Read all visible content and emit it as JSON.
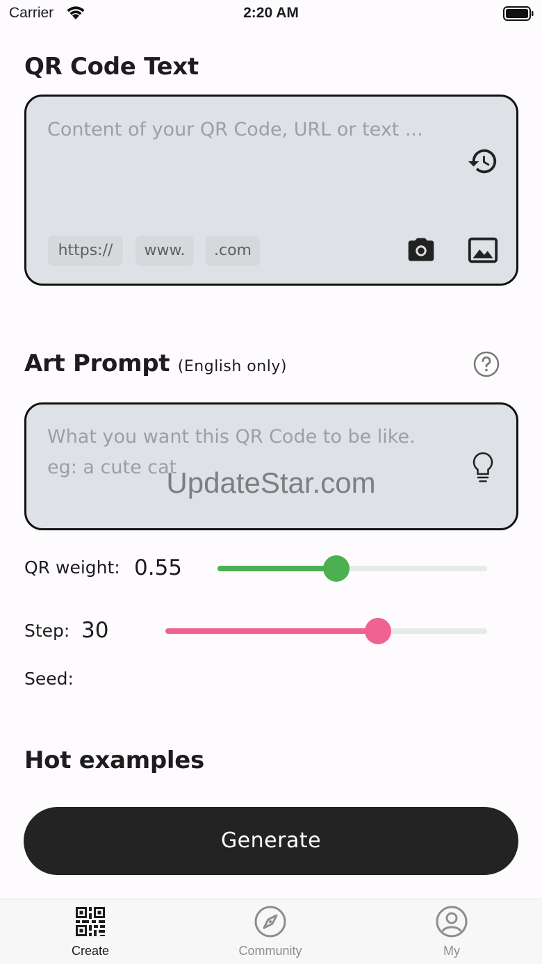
{
  "status_bar": {
    "carrier": "Carrier",
    "time": "2:20 AM"
  },
  "qr_section": {
    "title": "QR Code Text",
    "placeholder": "Content of your QR Code, URL or text ...",
    "chips": [
      "https://",
      "www.",
      ".com"
    ],
    "icons": [
      "history-icon",
      "camera-icon",
      "image-icon"
    ]
  },
  "art_section": {
    "title": "Art Prompt",
    "subtitle": "(English only)",
    "placeholder": "What you want this QR Code to be like. eg: a cute cat",
    "icons": [
      "help-icon",
      "lightbulb-icon"
    ]
  },
  "watermark": "UpdateStar.com",
  "params": {
    "qr_weight": {
      "label": "QR weight:",
      "value": "0.55",
      "fraction": 0.44,
      "color": "#4caf50"
    },
    "step": {
      "label": "Step:",
      "value": "30",
      "fraction": 0.66,
      "color": "#f06292"
    },
    "seed": {
      "label": "Seed:"
    }
  },
  "hot_examples": {
    "title": "Hot examples"
  },
  "generate_button": {
    "label": "Generate"
  },
  "tab_bar": {
    "tabs": [
      {
        "label": "Create",
        "icon": "qr-code-icon",
        "active": true
      },
      {
        "label": "Community",
        "icon": "compass-icon",
        "active": false
      },
      {
        "label": "My",
        "icon": "account-icon",
        "active": false
      }
    ]
  }
}
